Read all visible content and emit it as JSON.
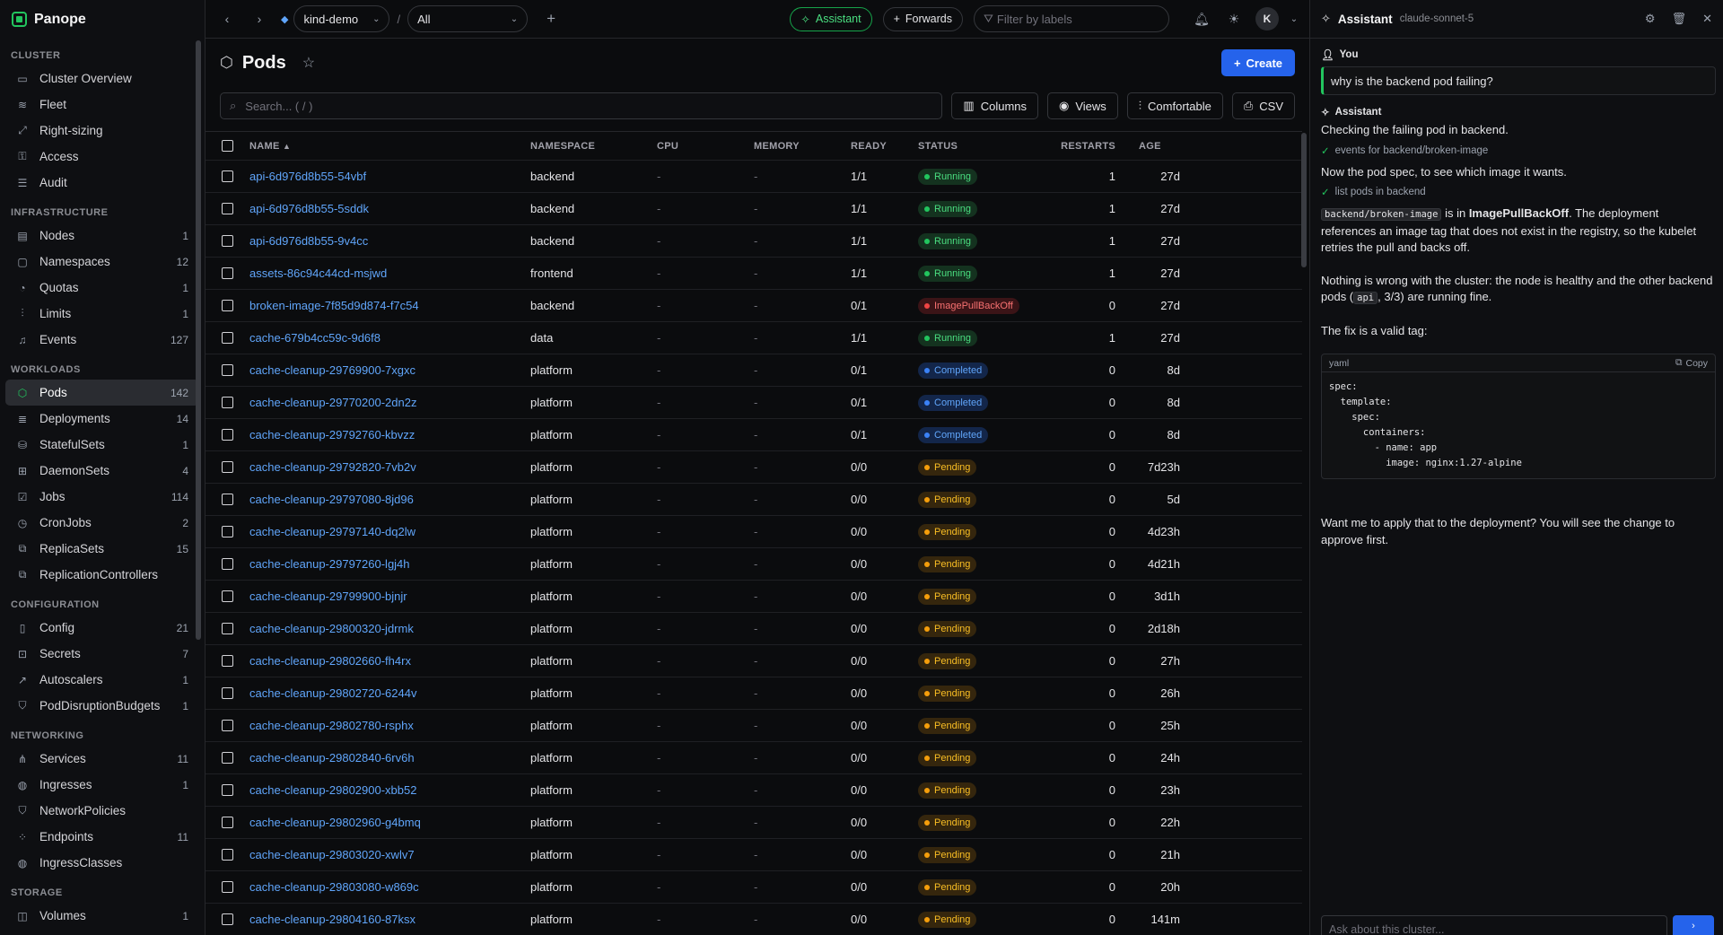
{
  "app": {
    "name": "Panope"
  },
  "sidebar": {
    "sections": [
      {
        "title": "CLUSTER",
        "items": [
          {
            "label": "Cluster Overview",
            "icon": "monitor-icon",
            "count": ""
          },
          {
            "label": "Fleet",
            "icon": "layers-icon",
            "count": ""
          },
          {
            "label": "Right-sizing",
            "icon": "resize-icon",
            "count": ""
          },
          {
            "label": "Access",
            "icon": "key-icon",
            "count": ""
          },
          {
            "label": "Audit",
            "icon": "list-icon",
            "count": ""
          }
        ]
      },
      {
        "title": "INFRASTRUCTURE",
        "items": [
          {
            "label": "Nodes",
            "icon": "server-icon",
            "count": "1"
          },
          {
            "label": "Namespaces",
            "icon": "folder-icon",
            "count": "12"
          },
          {
            "label": "Quotas",
            "icon": "gauge-icon",
            "count": "1"
          },
          {
            "label": "Limits",
            "icon": "sliders-icon",
            "count": "1"
          },
          {
            "label": "Events",
            "icon": "bell-icon",
            "count": "127"
          }
        ]
      },
      {
        "title": "WORKLOADS",
        "items": [
          {
            "label": "Pods",
            "icon": "cube-icon",
            "count": "142",
            "active": true
          },
          {
            "label": "Deployments",
            "icon": "stack-icon",
            "count": "14"
          },
          {
            "label": "StatefulSets",
            "icon": "database-icon",
            "count": "1"
          },
          {
            "label": "DaemonSets",
            "icon": "grid-icon",
            "count": "4"
          },
          {
            "label": "Jobs",
            "icon": "check-square-icon",
            "count": "114"
          },
          {
            "label": "CronJobs",
            "icon": "clock-icon",
            "count": "2"
          },
          {
            "label": "ReplicaSets",
            "icon": "copy-icon",
            "count": "15"
          },
          {
            "label": "ReplicationControllers",
            "icon": "copy-icon",
            "count": ""
          }
        ]
      },
      {
        "title": "CONFIGURATION",
        "items": [
          {
            "label": "Config",
            "icon": "file-icon",
            "count": "21"
          },
          {
            "label": "Secrets",
            "icon": "lock-icon",
            "count": "7"
          },
          {
            "label": "Autoscalers",
            "icon": "trend-icon",
            "count": "1"
          },
          {
            "label": "PodDisruptionBudgets",
            "icon": "shield-icon",
            "count": "1"
          }
        ]
      },
      {
        "title": "NETWORKING",
        "items": [
          {
            "label": "Services",
            "icon": "share-icon",
            "count": "11"
          },
          {
            "label": "Ingresses",
            "icon": "globe-icon",
            "count": "1"
          },
          {
            "label": "NetworkPolicies",
            "icon": "shield-icon",
            "count": ""
          },
          {
            "label": "Endpoints",
            "icon": "dots-icon",
            "count": "11"
          },
          {
            "label": "IngressClasses",
            "icon": "globe-icon",
            "count": ""
          }
        ]
      },
      {
        "title": "STORAGE",
        "items": [
          {
            "label": "Volumes",
            "icon": "disk-icon",
            "count": "1"
          }
        ]
      }
    ]
  },
  "topbar": {
    "context": "kind-demo",
    "separator": "/",
    "namespace": "All",
    "assistant_label": "Assistant",
    "forwards_label": "Forwards",
    "filter_placeholder": "Filter by labels",
    "avatar": "K"
  },
  "page": {
    "title": "Pods",
    "create_label": "Create",
    "search_placeholder": "Search... ( / )",
    "columns_label": "Columns",
    "views_label": "Views",
    "density_label": "Comfortable",
    "csv_label": "CSV"
  },
  "table": {
    "headers": {
      "name": "NAME",
      "namespace": "NAMESPACE",
      "cpu": "CPU",
      "memory": "MEMORY",
      "ready": "READY",
      "status": "STATUS",
      "restarts": "RESTARTS",
      "age": "AGE"
    },
    "rows": [
      {
        "name": "api-6d976d8b55-54vbf",
        "namespace": "backend",
        "cpu": "-",
        "memory": "-",
        "ready": "1/1",
        "status": "Running",
        "kind": "running",
        "restarts": "1",
        "age": "27d"
      },
      {
        "name": "api-6d976d8b55-5sddk",
        "namespace": "backend",
        "cpu": "-",
        "memory": "-",
        "ready": "1/1",
        "status": "Running",
        "kind": "running",
        "restarts": "1",
        "age": "27d"
      },
      {
        "name": "api-6d976d8b55-9v4cc",
        "namespace": "backend",
        "cpu": "-",
        "memory": "-",
        "ready": "1/1",
        "status": "Running",
        "kind": "running",
        "restarts": "1",
        "age": "27d"
      },
      {
        "name": "assets-86c94c44cd-msjwd",
        "namespace": "frontend",
        "cpu": "-",
        "memory": "-",
        "ready": "1/1",
        "status": "Running",
        "kind": "running",
        "restarts": "1",
        "age": "27d"
      },
      {
        "name": "broken-image-7f85d9d874-f7c54",
        "namespace": "backend",
        "cpu": "-",
        "memory": "-",
        "ready": "0/1",
        "status": "ImagePullBackOff",
        "kind": "err",
        "restarts": "0",
        "age": "27d"
      },
      {
        "name": "cache-679b4cc59c-9d6f8",
        "namespace": "data",
        "cpu": "-",
        "memory": "-",
        "ready": "1/1",
        "status": "Running",
        "kind": "running",
        "restarts": "1",
        "age": "27d"
      },
      {
        "name": "cache-cleanup-29769900-7xgxc",
        "namespace": "platform",
        "cpu": "-",
        "memory": "-",
        "ready": "0/1",
        "status": "Completed",
        "kind": "done",
        "restarts": "0",
        "age": "8d"
      },
      {
        "name": "cache-cleanup-29770200-2dn2z",
        "namespace": "platform",
        "cpu": "-",
        "memory": "-",
        "ready": "0/1",
        "status": "Completed",
        "kind": "done",
        "restarts": "0",
        "age": "8d"
      },
      {
        "name": "cache-cleanup-29792760-kbvzz",
        "namespace": "platform",
        "cpu": "-",
        "memory": "-",
        "ready": "0/1",
        "status": "Completed",
        "kind": "done",
        "restarts": "0",
        "age": "8d"
      },
      {
        "name": "cache-cleanup-29792820-7vb2v",
        "namespace": "platform",
        "cpu": "-",
        "memory": "-",
        "ready": "0/0",
        "status": "Pending",
        "kind": "pend",
        "restarts": "0",
        "age": "7d23h"
      },
      {
        "name": "cache-cleanup-29797080-8jd96",
        "namespace": "platform",
        "cpu": "-",
        "memory": "-",
        "ready": "0/0",
        "status": "Pending",
        "kind": "pend",
        "restarts": "0",
        "age": "5d"
      },
      {
        "name": "cache-cleanup-29797140-dq2lw",
        "namespace": "platform",
        "cpu": "-",
        "memory": "-",
        "ready": "0/0",
        "status": "Pending",
        "kind": "pend",
        "restarts": "0",
        "age": "4d23h"
      },
      {
        "name": "cache-cleanup-29797260-lgj4h",
        "namespace": "platform",
        "cpu": "-",
        "memory": "-",
        "ready": "0/0",
        "status": "Pending",
        "kind": "pend",
        "restarts": "0",
        "age": "4d21h"
      },
      {
        "name": "cache-cleanup-29799900-bjnjr",
        "namespace": "platform",
        "cpu": "-",
        "memory": "-",
        "ready": "0/0",
        "status": "Pending",
        "kind": "pend",
        "restarts": "0",
        "age": "3d1h"
      },
      {
        "name": "cache-cleanup-29800320-jdrmk",
        "namespace": "platform",
        "cpu": "-",
        "memory": "-",
        "ready": "0/0",
        "status": "Pending",
        "kind": "pend",
        "restarts": "0",
        "age": "2d18h"
      },
      {
        "name": "cache-cleanup-29802660-fh4rx",
        "namespace": "platform",
        "cpu": "-",
        "memory": "-",
        "ready": "0/0",
        "status": "Pending",
        "kind": "pend",
        "restarts": "0",
        "age": "27h"
      },
      {
        "name": "cache-cleanup-29802720-6244v",
        "namespace": "platform",
        "cpu": "-",
        "memory": "-",
        "ready": "0/0",
        "status": "Pending",
        "kind": "pend",
        "restarts": "0",
        "age": "26h"
      },
      {
        "name": "cache-cleanup-29802780-rsphx",
        "namespace": "platform",
        "cpu": "-",
        "memory": "-",
        "ready": "0/0",
        "status": "Pending",
        "kind": "pend",
        "restarts": "0",
        "age": "25h"
      },
      {
        "name": "cache-cleanup-29802840-6rv6h",
        "namespace": "platform",
        "cpu": "-",
        "memory": "-",
        "ready": "0/0",
        "status": "Pending",
        "kind": "pend",
        "restarts": "0",
        "age": "24h"
      },
      {
        "name": "cache-cleanup-29802900-xbb52",
        "namespace": "platform",
        "cpu": "-",
        "memory": "-",
        "ready": "0/0",
        "status": "Pending",
        "kind": "pend",
        "restarts": "0",
        "age": "23h"
      },
      {
        "name": "cache-cleanup-29802960-g4bmq",
        "namespace": "platform",
        "cpu": "-",
        "memory": "-",
        "ready": "0/0",
        "status": "Pending",
        "kind": "pend",
        "restarts": "0",
        "age": "22h"
      },
      {
        "name": "cache-cleanup-29803020-xwlv7",
        "namespace": "platform",
        "cpu": "-",
        "memory": "-",
        "ready": "0/0",
        "status": "Pending",
        "kind": "pend",
        "restarts": "0",
        "age": "21h"
      },
      {
        "name": "cache-cleanup-29803080-w869c",
        "namespace": "platform",
        "cpu": "-",
        "memory": "-",
        "ready": "0/0",
        "status": "Pending",
        "kind": "pend",
        "restarts": "0",
        "age": "20h"
      },
      {
        "name": "cache-cleanup-29804160-87ksx",
        "namespace": "platform",
        "cpu": "-",
        "memory": "-",
        "ready": "0/0",
        "status": "Pending",
        "kind": "pend",
        "restarts": "0",
        "age": "141m"
      }
    ]
  },
  "assistant": {
    "title": "Assistant",
    "model": "claude-sonnet-5",
    "user_label": "You",
    "user_message": "why is the backend pod failing?",
    "assistant_label": "Assistant",
    "msg1": "Checking the failing pod in backend.",
    "tool1": "events for backend/broken-image",
    "msg2": "Now the pod spec, to see which image it wants.",
    "tool2": "list pods in backend",
    "pod_code": "backend/broken-image",
    "msg3_a": "is in",
    "msg3_status": "ImagePullBackOff",
    "msg3_b": ". The deployment references an image tag that does not exist in the registry, so the kubelet retries the pull and backs off.",
    "msg4_a": "Nothing is wrong with the cluster: the node is healthy and the other backend pods (",
    "msg4_code": "api",
    "msg4_b": ", 3/3) are running fine.",
    "msg5": "The fix is a valid tag:",
    "code_lang": "yaml",
    "copy_label": "Copy",
    "code": "spec:\n  template:\n    spec:\n      containers:\n        - name: app\n          image: nginx:1.27-alpine",
    "msg6": "Want me to apply that to the deployment? You will see the change to approve first.",
    "input_placeholder": "Ask about this cluster..."
  }
}
